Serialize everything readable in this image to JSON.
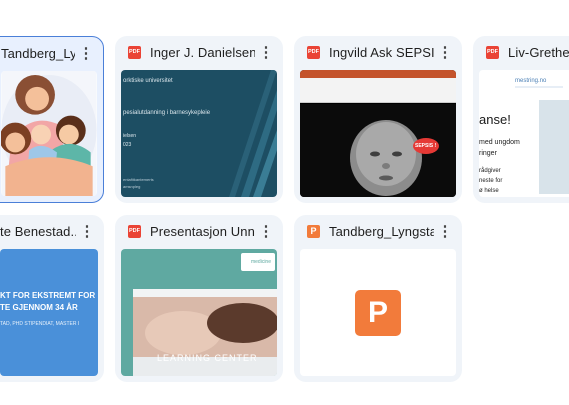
{
  "files": [
    {
      "title": "Tandberg_Lyngstad...",
      "type": "illustration"
    },
    {
      "title": "Inger J. Danielsen....",
      "type": "pdf",
      "slide": {
        "line1": "orktiske universitet",
        "line2": "pesialutdanning i barnesykepleie",
        "line3": "ielsen",
        "line4": "023",
        "footer1": "entafitkantemerts",
        "footer2": "amsnpleg"
      }
    },
    {
      "title": "Ingvild Ask SEPSIS...",
      "type": "pdf",
      "slide": {
        "badge": "SEPSIS !"
      }
    },
    {
      "title": "Liv-Grethe K",
      "type": "pdf",
      "slide": {
        "brand": "mestring.no",
        "heading": "anse!",
        "t1": "med ungdom",
        "t2": "ringer",
        "t3": "rådgiver",
        "t4": "neste for",
        "t5": "ø helse"
      }
    },
    {
      "title": "te Benestad....",
      "type": "pdf",
      "slide": {
        "l1": "KT FOR EKSTREMT FOR",
        "l2": "TE GJENNOM 34 ÅR",
        "l3": "TAD, PHD STIPENDIAT, MASTER I"
      }
    },
    {
      "title": "Presentasjon Unni ....",
      "type": "pdf",
      "slide": {
        "banner": "LEARNING CENTER",
        "logo": "medicine"
      }
    },
    {
      "title": "Tandberg_Lyngsta...",
      "type": "ppt",
      "slide": {
        "letter": "P"
      }
    }
  ],
  "icons": {
    "pdf_label": "PDF",
    "ppt_label": "P",
    "more": "⋮"
  },
  "colors": {
    "pdf": "#ea4335",
    "ppt": "#f27b3b",
    "card": "#f0f4f9",
    "selected_border": "#4a7fd8"
  }
}
